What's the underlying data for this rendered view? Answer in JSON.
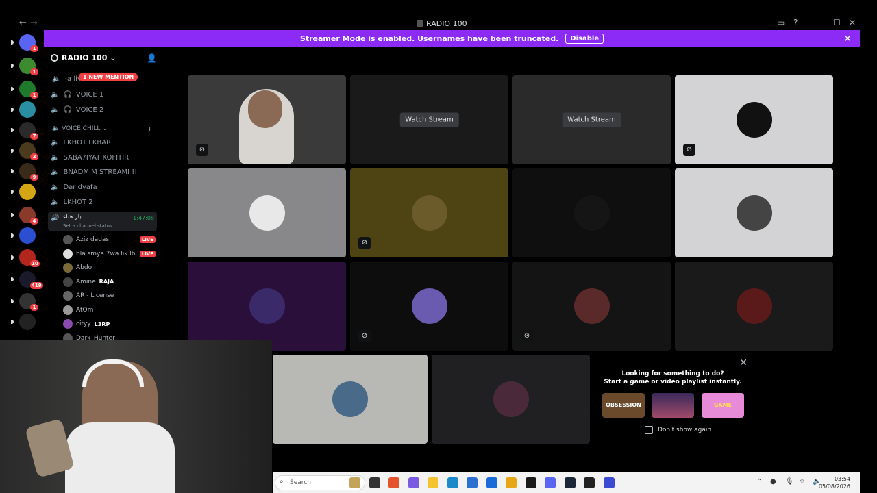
{
  "window": {
    "title": "RADIO 100"
  },
  "banner": {
    "text": "Streamer Mode is enabled. Usernames have been truncated.",
    "button": "Disable"
  },
  "guilds": [
    {
      "color": "#5865f2",
      "badge": "1"
    },
    {
      "color": "#3d8a2f",
      "badge": "1"
    },
    {
      "color": "#1f7a2b",
      "badge": "1"
    },
    {
      "color": "#2b8fa3",
      "badge": ""
    },
    {
      "color": "#2a2a2a",
      "badge": "7"
    },
    {
      "color": "#4a3b1c",
      "badge": "2"
    },
    {
      "color": "#3a2a1a",
      "badge": "9"
    },
    {
      "color": "#d4a514",
      "badge": ""
    },
    {
      "color": "#8a3a2a",
      "badge": "4"
    },
    {
      "color": "#2b4fd1",
      "badge": ""
    },
    {
      "color": "#b3261e",
      "badge": "10"
    },
    {
      "color": "#1a1a2a",
      "badge": "419"
    },
    {
      "color": "#333",
      "badge": "1"
    },
    {
      "color": "#222",
      "badge": ""
    }
  ],
  "sidebar": {
    "server_name": "RADIO 100",
    "mention_pill": "1 NEW MENTION",
    "partial_channel": "-a          live",
    "channels_top": [
      {
        "label": "VOICE 1"
      },
      {
        "label": "VOICE 2"
      }
    ],
    "category": "VOICE CHILL",
    "voice_channels": [
      {
        "label": "LKHOT LKBAR"
      },
      {
        "label": "SABA7IYAT KOFITIR"
      },
      {
        "label": "BNADM M STREAMI !!"
      },
      {
        "label": "Dar dyafa"
      },
      {
        "label": "LKHOT 2"
      }
    ],
    "active_channel": {
      "name": "بار هناء",
      "status": "Set a channel status",
      "time": "1:47:08"
    },
    "users": [
      {
        "name": "Aziz dadas",
        "live": "LIVE",
        "color": "#555"
      },
      {
        "name": "bla smya 7wa lik lb...",
        "live": "LIVE",
        "color": "#ddd"
      },
      {
        "name": "Abdo",
        "live": "",
        "color": "#7a6a3a"
      },
      {
        "name": "Amine",
        "tag": "RAJA",
        "live": "",
        "color": "#444"
      },
      {
        "name": "AR - License",
        "live": "",
        "color": "#666"
      },
      {
        "name": "AtOm",
        "live": "",
        "color": "#999"
      },
      {
        "name": "cityy",
        "tag": "L3RP",
        "live": "",
        "color": "#8a4ab0"
      },
      {
        "name": "Dark_Hunter",
        "live": "",
        "color": "#555"
      }
    ]
  },
  "grid": {
    "watch_label": "Watch Stream",
    "tiles": [
      {
        "bg": "#3a3a3a",
        "kind": "video",
        "deaf": true
      },
      {
        "bg": "#1a1a1a",
        "kind": "stream",
        "deaf": false
      },
      {
        "bg": "#2a2a2a",
        "kind": "stream",
        "deaf": false
      },
      {
        "bg": "#d3d3d5",
        "kind": "avatar",
        "av": "#111",
        "deaf": true
      },
      {
        "bg": "#88888a",
        "kind": "avatar",
        "av": "#e8e8e8",
        "deaf": false
      },
      {
        "bg": "#4d4313",
        "kind": "avatar",
        "av": "#6b5a2a",
        "deaf": true
      },
      {
        "bg": "#0f0f0f",
        "kind": "avatar",
        "av": "#151515",
        "deaf": false
      },
      {
        "bg": "#d3d3d5",
        "kind": "avatar",
        "av": "#444",
        "deaf": false
      },
      {
        "bg": "#2a0f3a",
        "kind": "avatar",
        "av": "#3a2a6a",
        "deaf": false
      },
      {
        "bg": "#0d0d0d",
        "kind": "avatar",
        "av": "#6a5ab0",
        "deaf": true
      },
      {
        "bg": "#141414",
        "kind": "avatar",
        "av": "#5a2a2a",
        "deaf": true
      },
      {
        "bg": "#1a1a1a",
        "kind": "avatar",
        "av": "#5a1a1a",
        "deaf": false
      },
      {
        "bg": "#b8b8b5",
        "kind": "avatar",
        "av": "#4a6a8a",
        "deaf": false
      },
      {
        "bg": "#202022",
        "kind": "avatar",
        "av": "#4a2a3a",
        "deaf": false
      }
    ]
  },
  "suggestion": {
    "line1": "Looking for something to do?",
    "line2": "Start a game or video playlist instantly.",
    "checkbox": "Don't show again",
    "tiles": [
      {
        "color": "#6a4a2a",
        "label": "OBSESSION"
      },
      {
        "color": "#6a3a7a",
        "label": ""
      },
      {
        "color": "#e78ad8",
        "label": "GAME"
      }
    ]
  },
  "taskbar": {
    "search": "Search",
    "time": "03:54",
    "date": "05/08/2026",
    "apps": [
      "#c4a35a",
      "#333",
      "#e5532d",
      "#7a5ae0",
      "#f4c430",
      "#1b8ac9",
      "#2b6fd1",
      "#1a6ad8",
      "#e6a817",
      "#1a1a1a",
      "#5865f2",
      "#1b2838",
      "#222",
      "#3a4ad1"
    ]
  }
}
